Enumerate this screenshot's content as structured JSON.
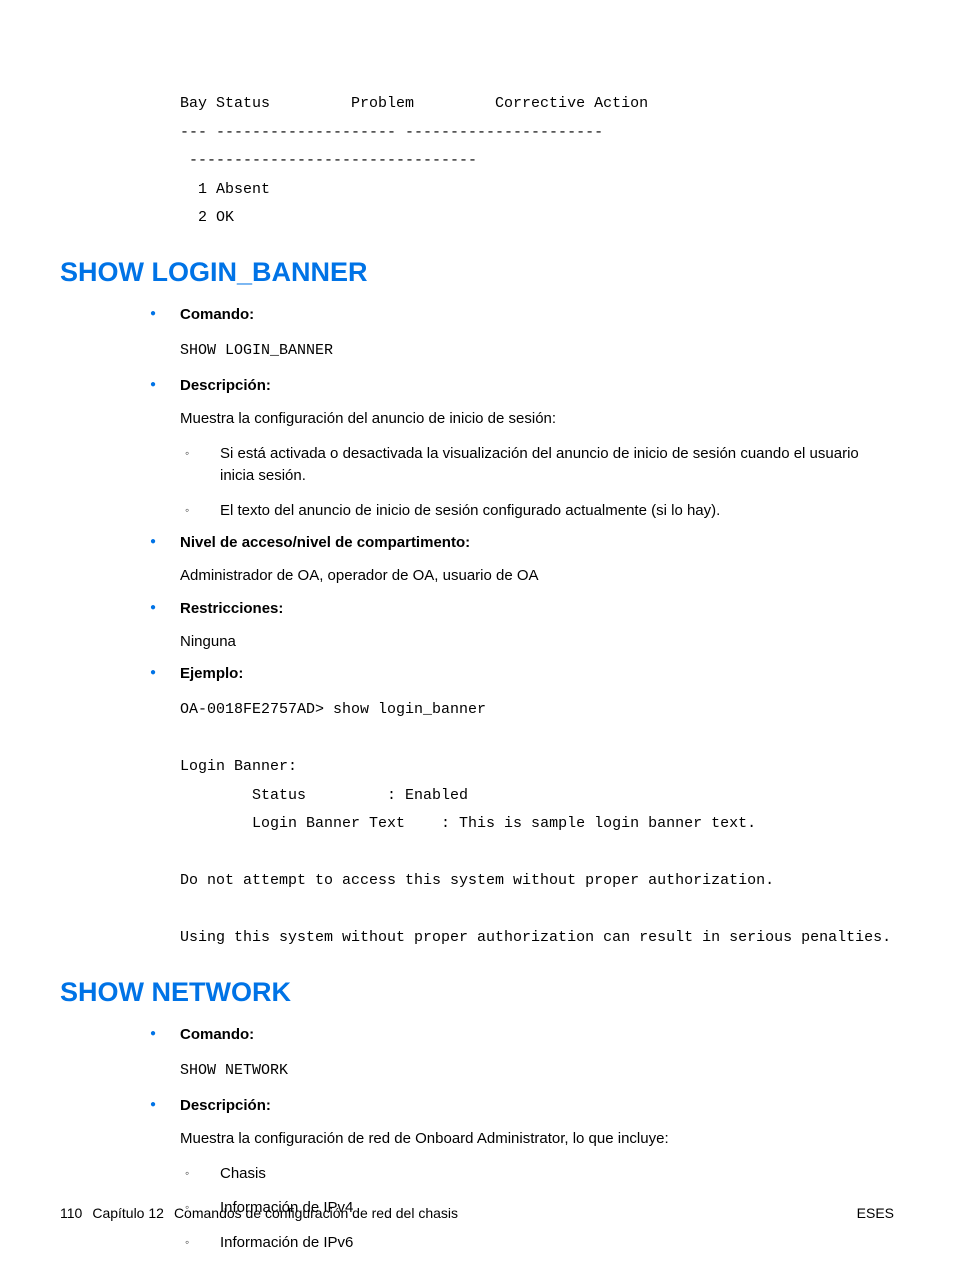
{
  "intro_code": "Bay Status         Problem         Corrective Action\n--- -------------------- ----------------------\n --------------------------------\n  1 Absent\n  2 OK",
  "section1": {
    "heading": "SHOW LOGIN_BANNER",
    "comando_label": "Comando:",
    "comando_value": "SHOW LOGIN_BANNER",
    "descripcion_label": "Descripción:",
    "descripcion_text": "Muestra la configuración del anuncio de inicio de sesión:",
    "sub1": "Si está activada o desactivada la visualización del anuncio de inicio de sesión cuando el usuario inicia sesión.",
    "sub2": "El texto del anuncio de inicio de sesión configurado actualmente (si lo hay).",
    "nivel_label": "Nivel de acceso/nivel de compartimento:",
    "nivel_text": "Administrador de OA, operador de OA, usuario de OA",
    "restr_label": "Restricciones:",
    "restr_text": "Ninguna",
    "ejemplo_label": "Ejemplo:",
    "ejemplo_text": "OA-0018FE2757AD> show login_banner\n\nLogin Banner:\n        Status         : Enabled\n        Login Banner Text    : This is sample login banner text.\n\nDo not attempt to access this system without proper authorization.\n\nUsing this system without proper authorization can result in serious penalties."
  },
  "section2": {
    "heading": "SHOW NETWORK",
    "comando_label": "Comando:",
    "comando_value": "SHOW NETWORK",
    "descripcion_label": "Descripción:",
    "descripcion_text": "Muestra la configuración de red de Onboard Administrator, lo que incluye:",
    "sub1": "Chasis",
    "sub2": "Información de IPv4",
    "sub3": "Información de IPv6"
  },
  "footer": {
    "page": "110",
    "chapter": "Capítulo 12",
    "title": "Comandos de configuración de red del chasis",
    "right": "ESES"
  }
}
